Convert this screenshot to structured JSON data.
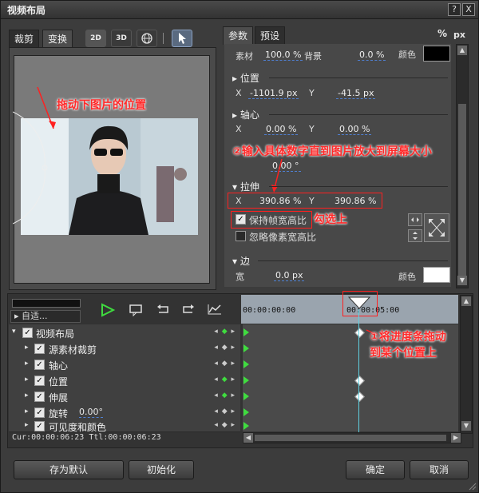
{
  "window": {
    "title": "视频布局",
    "help_btn": "?",
    "close_btn": "X"
  },
  "left_panel": {
    "tabs": [
      "裁剪",
      "变换"
    ],
    "tools": [
      "2D",
      "3D"
    ]
  },
  "annotations": {
    "drag_image": "拖动下图片的位置",
    "enter_numbers": "②输入具体数字直到图片放大到屏幕大小",
    "check_it": "勾选上",
    "drag_progress_1": "①将进度条拖动",
    "drag_progress_2": "到某个位置上"
  },
  "right_panel": {
    "tabs": [
      "参数",
      "预设"
    ],
    "unit_percent": "%",
    "unit_px": "px",
    "material_label": "素材",
    "material_value": "100.0 %",
    "background_label": "背景",
    "background_value": "0.0 %",
    "color_label": "颜色",
    "position": {
      "title": "位置",
      "x_label": "X",
      "x_value": "-1101.9 px",
      "y_label": "Y",
      "y_value": "-41.5 px"
    },
    "axis": {
      "title": "轴心",
      "x_label": "X",
      "x_value": "0.00 %",
      "y_label": "Y",
      "y_value": "0.00 %"
    },
    "rotation_value": "0.00 °",
    "stretch": {
      "title": "拉伸",
      "x_label": "X",
      "x_value": "390.86 %",
      "y_label": "Y",
      "y_value": "390.86 %"
    },
    "keep_aspect": "保持帧宽高比",
    "ignore_pixel_aspect": "忽略像素宽高比",
    "edge": {
      "title": "边",
      "width_label": "宽",
      "width_value": "0.0 px",
      "color_label": "颜色"
    },
    "colors": {
      "bg_swatch": "#000000",
      "edge_swatch": "#ffffff"
    }
  },
  "timeline": {
    "dropdown": "自适...",
    "timestamps": [
      "00:00:00:00",
      "00:00:05:00"
    ],
    "tracks": [
      {
        "name": "视频布局"
      },
      {
        "name": "源素材裁剪"
      },
      {
        "name": "轴心"
      },
      {
        "name": "位置"
      },
      {
        "name": "伸展"
      },
      {
        "name": "旋转",
        "extra": "0.00°"
      },
      {
        "name": "可见度和颜色"
      }
    ],
    "status": "Cur:00:00:06:23  Ttl:00:00:06:23"
  },
  "footer": {
    "save_default": "存为默认",
    "initialize": "初始化",
    "ok": "确定",
    "cancel": "取消"
  }
}
